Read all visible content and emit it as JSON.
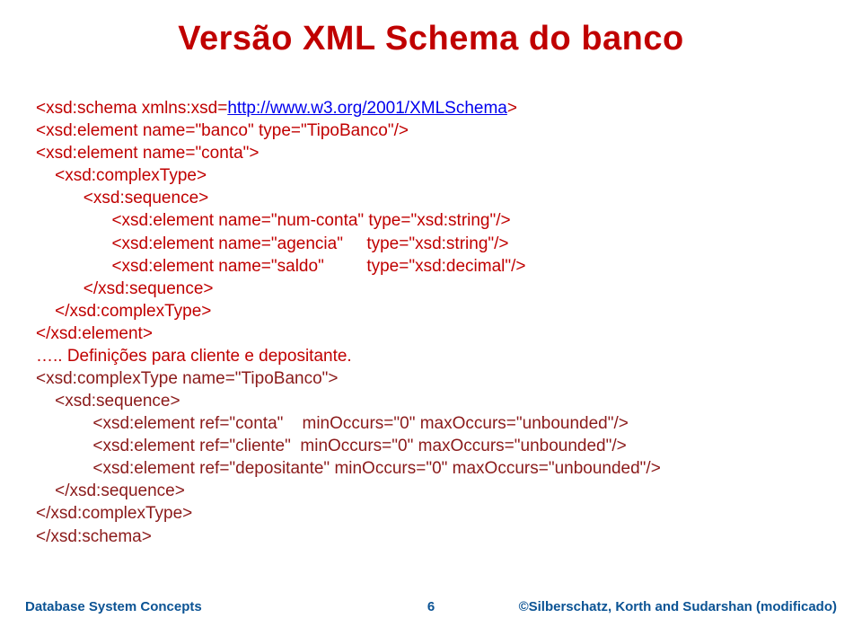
{
  "title": "Versão XML Schema do banco",
  "schema_open_prefix": "<xsd:schema xmlns:xsd=",
  "schema_url": "http://www.w3.org/2001/XMLSchema",
  "schema_open_suffix": ">",
  "l1": "<xsd:element name=\"banco\" type=\"TipoBanco\"/>",
  "l2": "<xsd:element name=\"conta\">",
  "l3": "    <xsd:complexType>",
  "l4": "          <xsd:sequence>",
  "l5": "                <xsd:element name=\"num-conta\" type=\"xsd:string\"/>",
  "l6": "                <xsd:element name=\"agencia\"     type=\"xsd:string\"/>",
  "l7": "                <xsd:element name=\"saldo\"         type=\"xsd:decimal\"/>",
  "l8": "          </xsd:sequence>",
  "l9": "    </xsd:complexType>",
  "l10": "</xsd:element>",
  "l11": "….. Definições para cliente e depositante.",
  "d1": "<xsd:complexType name=\"TipoBanco\">",
  "d2": "    <xsd:sequence>",
  "d3": "            <xsd:element ref=\"conta\"    minOccurs=\"0\" maxOccurs=\"unbounded\"/>",
  "d4": "            <xsd:element ref=\"cliente\"  minOccurs=\"0\" maxOccurs=\"unbounded\"/>",
  "d5": "            <xsd:element ref=\"depositante\" minOccurs=\"0\" maxOccurs=\"unbounded\"/>",
  "d6": "    </xsd:sequence>",
  "d7": "</xsd:complexType>",
  "d8": "</xsd:schema>",
  "footer": {
    "left": "Database System Concepts",
    "center": "6",
    "right": "©Silberschatz, Korth and Sudarshan (modificado)"
  }
}
